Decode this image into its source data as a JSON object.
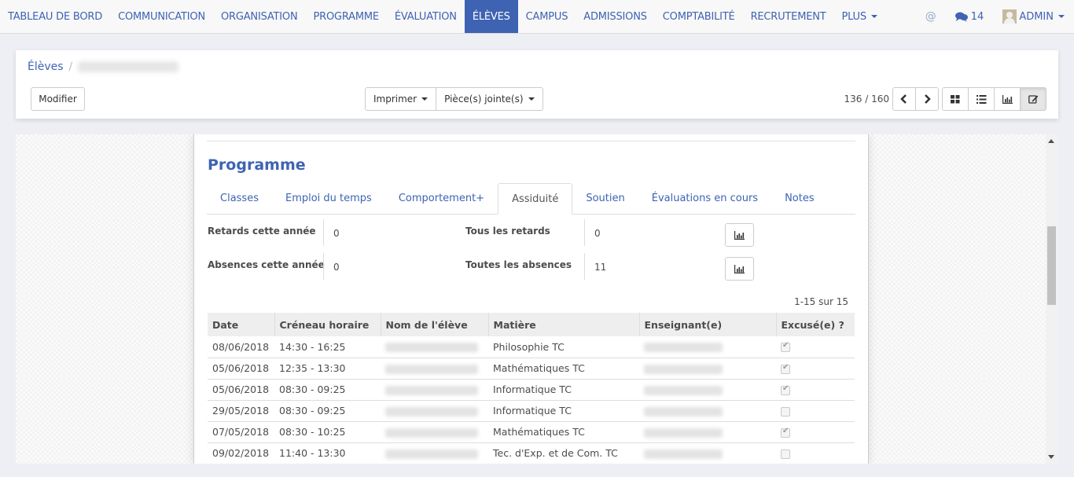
{
  "nav": {
    "items": [
      {
        "label": "TABLEAU DE BORD",
        "active": false
      },
      {
        "label": "COMMUNICATION",
        "active": false
      },
      {
        "label": "ORGANISATION",
        "active": false
      },
      {
        "label": "PROGRAMME",
        "active": false
      },
      {
        "label": "ÉVALUATION",
        "active": false
      },
      {
        "label": "ÉLÈVES",
        "active": true
      },
      {
        "label": "CAMPUS",
        "active": false
      },
      {
        "label": "ADMISSIONS",
        "active": false
      },
      {
        "label": "COMPTABILITÉ",
        "active": false
      },
      {
        "label": "RECRUTEMENT",
        "active": false
      },
      {
        "label": "PLUS",
        "active": false
      }
    ],
    "at_icon": "@",
    "messages_count": "14",
    "user_label": "ADMIN",
    "accent_color": "#3e63b3"
  },
  "breadcrumb": {
    "parent": "Élèves",
    "separator": "/",
    "current": "[blurred student name]"
  },
  "toolbar": {
    "edit_label": "Modifier",
    "print_label": "Imprimer",
    "attachments_label": "Pièce(s) jointe(s)",
    "pager_value": "136 / 160",
    "views": [
      "kanban",
      "list",
      "graph",
      "form"
    ],
    "active_view": "form"
  },
  "sheet": {
    "section_title": "Programme",
    "tabs": [
      {
        "label": "Classes",
        "active": false
      },
      {
        "label": "Emploi du temps",
        "active": false
      },
      {
        "label": "Comportement+",
        "active": false
      },
      {
        "label": "Assiduité",
        "active": true
      },
      {
        "label": "Soutien",
        "active": false
      },
      {
        "label": "Évaluations en cours",
        "active": false
      },
      {
        "label": "Notes",
        "active": false
      }
    ],
    "fields": {
      "late_year_label": "Retards cette année",
      "late_year_value": "0",
      "late_all_label": "Tous les retards",
      "late_all_value": "0",
      "absence_year_label": "Absences cette année",
      "absence_year_value": "0",
      "absence_all_label": "Toutes les absences",
      "absence_all_value": "11"
    },
    "list_pager": "1-15 sur 15",
    "table": {
      "headers": [
        "Date",
        "Créneau horaire",
        "Nom de l'élève",
        "Matière",
        "Enseignant(e)",
        "Excusé(e) ?"
      ],
      "rows": [
        {
          "date": "08/06/2018",
          "slot": "14:30 - 16:25",
          "student": "[blurred]",
          "subject": "Philosophie TC",
          "teacher": "[blurred]",
          "excused": true
        },
        {
          "date": "05/06/2018",
          "slot": "12:35 - 13:30",
          "student": "[blurred]",
          "subject": "Mathématiques TC",
          "teacher": "[blurred]",
          "excused": true
        },
        {
          "date": "05/06/2018",
          "slot": "08:30 - 09:25",
          "student": "[blurred]",
          "subject": "Informatique TC",
          "teacher": "[blurred]",
          "excused": true
        },
        {
          "date": "29/05/2018",
          "slot": "08:30 - 09:25",
          "student": "[blurred]",
          "subject": "Informatique TC",
          "teacher": "[blurred]",
          "excused": false
        },
        {
          "date": "07/05/2018",
          "slot": "08:30 - 10:25",
          "student": "[blurred]",
          "subject": "Mathématiques TC",
          "teacher": "[blurred]",
          "excused": true
        },
        {
          "date": "09/02/2018",
          "slot": "11:40 - 13:30",
          "student": "[blurred]",
          "subject": "Tec. d'Exp. et de Com. TC",
          "teacher": "[blurred]",
          "excused": false
        }
      ]
    }
  }
}
